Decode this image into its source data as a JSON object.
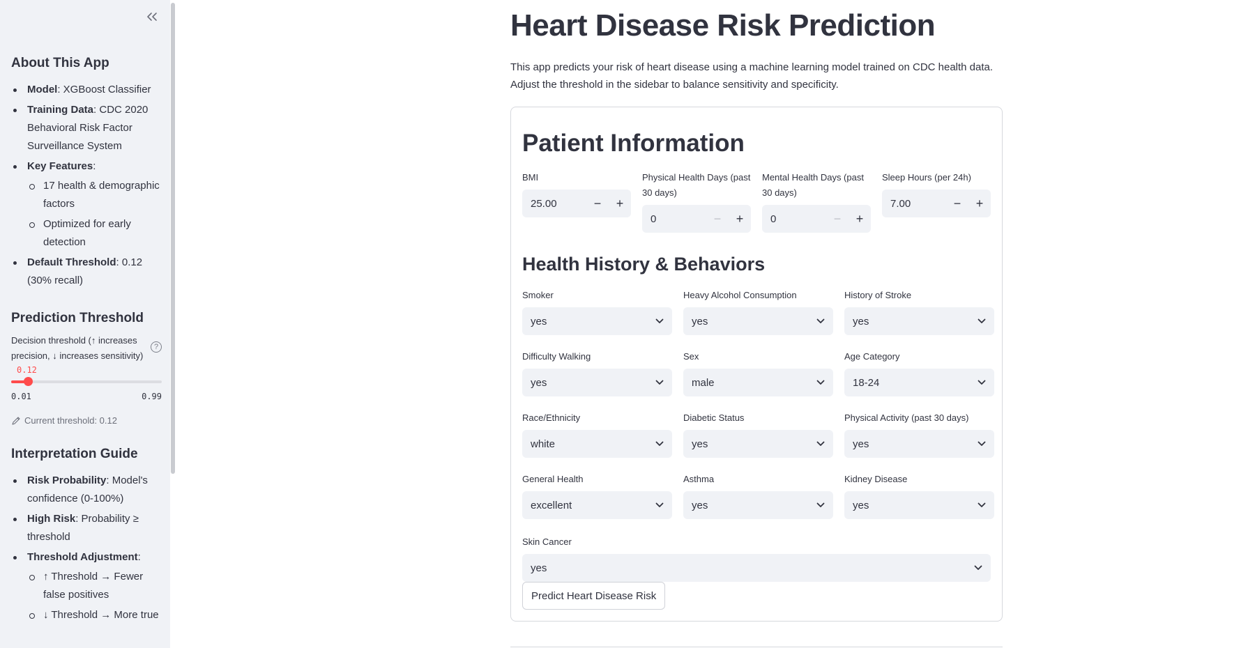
{
  "sidebar": {
    "about": {
      "title": "About This App",
      "items": [
        {
          "label": "Model",
          "text": ": XGBoost Classifier"
        },
        {
          "label": "Training Data",
          "text": ": CDC 2020 Behavioral Risk Factor Surveillance System"
        },
        {
          "label": "Key Features",
          "text": ":",
          "sub": [
            "17 health & demographic factors",
            "Optimized for early detection"
          ]
        },
        {
          "label": "Default Threshold",
          "text": ": 0.12 (30% recall)"
        }
      ]
    },
    "threshold": {
      "title": "Prediction Threshold",
      "slider_label": "Decision threshold (↑ increases precision, ↓ increases sensitivity)",
      "value": "0.12",
      "min": "0.01",
      "max": "0.99",
      "fraction": 0.11,
      "caption": "Current threshold: 0.12"
    },
    "guide": {
      "title": "Interpretation Guide",
      "items": [
        {
          "label": "Risk Probability",
          "text": ": Model's confidence (0-100%)"
        },
        {
          "label": "High Risk",
          "text": ": Probability ≥ threshold"
        },
        {
          "label": "Threshold Adjustment",
          "text": ":",
          "sub": [
            "↑ Threshold → Fewer false positives",
            "↓ Threshold → More true"
          ]
        }
      ]
    }
  },
  "main": {
    "title": "Heart Disease Risk Prediction",
    "intro": "This app predicts your risk of heart disease using a machine learning model trained on CDC health data. Adjust the threshold in the sidebar to balance sensitivity and specificity.",
    "patient_title": "Patient Information",
    "numbers": [
      {
        "label": "BMI",
        "value": "25.00",
        "minus_disabled": false
      },
      {
        "label": "Physical Health Days (past 30 days)",
        "value": "0",
        "minus_disabled": true
      },
      {
        "label": "Mental Health Days (past 30 days)",
        "value": "0",
        "minus_disabled": true
      },
      {
        "label": "Sleep Hours (per 24h)",
        "value": "7.00",
        "minus_disabled": false
      }
    ],
    "history_title": "Health History & Behaviors",
    "selects": [
      {
        "label": "Smoker",
        "value": "yes"
      },
      {
        "label": "Heavy Alcohol Consumption",
        "value": "yes"
      },
      {
        "label": "History of Stroke",
        "value": "yes"
      },
      {
        "label": "Difficulty Walking",
        "value": "yes"
      },
      {
        "label": "Sex",
        "value": "male"
      },
      {
        "label": "Age Category",
        "value": "18-24"
      },
      {
        "label": "Race/Ethnicity",
        "value": "white"
      },
      {
        "label": "Diabetic Status",
        "value": "yes"
      },
      {
        "label": "Physical Activity (past 30 days)",
        "value": "yes"
      },
      {
        "label": "General Health",
        "value": "excellent"
      },
      {
        "label": "Asthma",
        "value": "yes"
      },
      {
        "label": "Kidney Disease",
        "value": "yes"
      }
    ],
    "skin_cancer": {
      "label": "Skin Cancer",
      "value": "yes"
    },
    "predict_label": "Predict Heart Disease Risk"
  },
  "icons": {
    "collapse": "double-chevron-left-icon",
    "help": "question-circle-icon",
    "pencil": "pencil-icon",
    "select": "chevron-down-icon"
  },
  "colors": {
    "accent": "#ff4b4b",
    "sidebar_bg": "#f0f2f6",
    "text": "#31333f"
  }
}
